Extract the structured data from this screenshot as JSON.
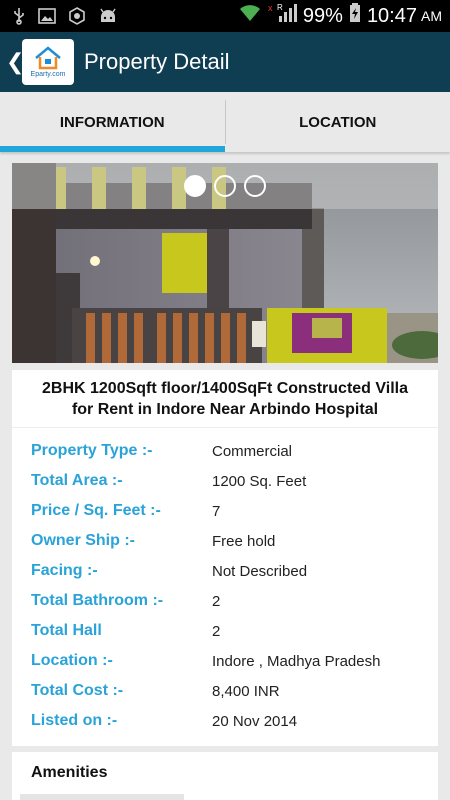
{
  "status_bar": {
    "battery": "99%",
    "time": "10:47",
    "ampm": "AM",
    "roaming": "R",
    "icons": [
      "usb-icon",
      "image-icon",
      "app-icon",
      "android-icon",
      "wifi-icon",
      "signal-icon",
      "battery-icon"
    ]
  },
  "app_bar": {
    "back_chevron": "❮",
    "logo_text": "Eparty.com",
    "title": "Property Detail"
  },
  "tabs": [
    {
      "label": "INFORMATION",
      "active": true
    },
    {
      "label": "LOCATION",
      "active": false
    }
  ],
  "carousel": {
    "pages": 3,
    "current": 1
  },
  "property": {
    "title": "2BHK 1200Sqft floor/1400SqFt Constructed Villa for Rent in Indore Near Arbindo Hospital",
    "details": [
      {
        "label": "Property Type :-",
        "value": "Commercial"
      },
      {
        "label": "Total Area :-",
        "value": "1200 Sq. Feet"
      },
      {
        "label": "Price / Sq. Feet :-",
        "value": "7"
      },
      {
        "label": "Owner Ship :-",
        "value": "Free hold"
      },
      {
        "label": "Facing :-",
        "value": "Not Described"
      },
      {
        "label": "Total Bathroom :-",
        "value": "2"
      },
      {
        "label": "Total Hall",
        "value": "2"
      },
      {
        "label": "Location :-",
        "value": "Indore , Madhya Pradesh"
      },
      {
        "label": "Total Cost :-",
        "value": "8,400 INR"
      },
      {
        "label": "Listed on :-",
        "value": "20 Nov 2014"
      }
    ]
  },
  "amenities": {
    "title": "Amenities"
  },
  "colors": {
    "app_bar": "#0f3d52",
    "accent": "#21a6dc",
    "label": "#2aa3d8",
    "background": "#e9e9e9"
  }
}
